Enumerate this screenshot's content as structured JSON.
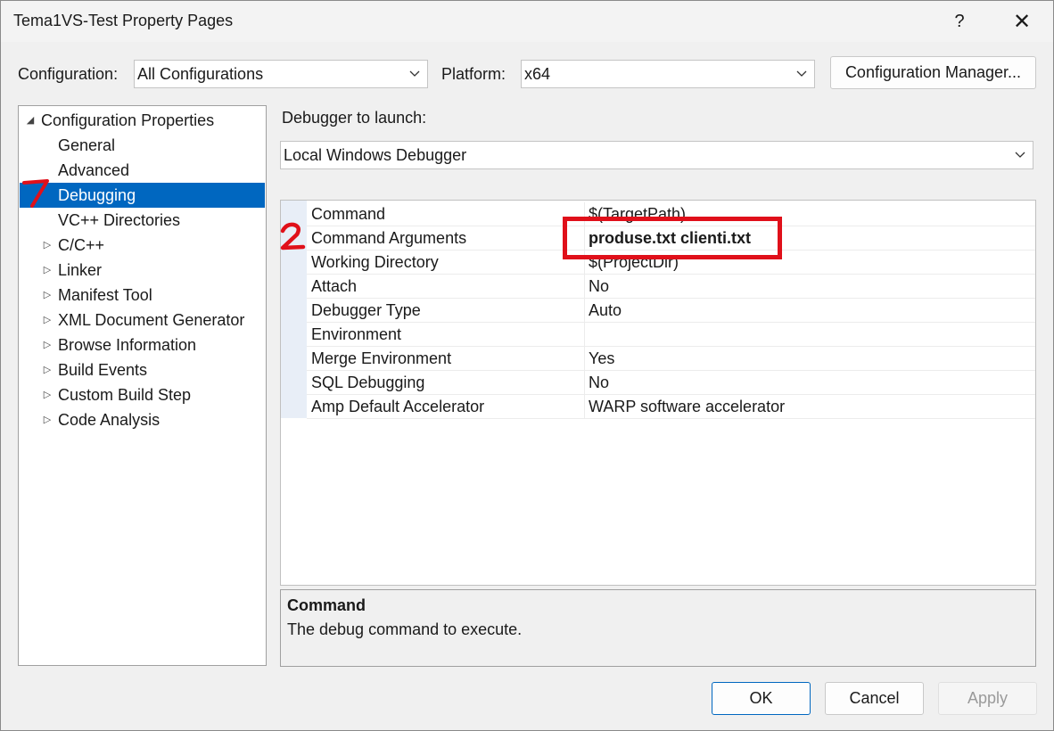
{
  "window": {
    "title": "Tema1VS-Test Property Pages",
    "help_glyph": "?",
    "close_glyph": "✕"
  },
  "toolbar": {
    "configuration_label": "Configuration:",
    "configuration_value": "All Configurations",
    "platform_label": "Platform:",
    "platform_value": "x64",
    "config_manager_label": "Configuration Manager..."
  },
  "tree": {
    "root": {
      "label": "Configuration Properties",
      "expanded": true
    },
    "items": [
      {
        "label": "General",
        "expandable": false,
        "selected": false
      },
      {
        "label": "Advanced",
        "expandable": false,
        "selected": false
      },
      {
        "label": "Debugging",
        "expandable": false,
        "selected": true
      },
      {
        "label": "VC++ Directories",
        "expandable": false,
        "selected": false
      },
      {
        "label": "C/C++",
        "expandable": true,
        "selected": false
      },
      {
        "label": "Linker",
        "expandable": true,
        "selected": false
      },
      {
        "label": "Manifest Tool",
        "expandable": true,
        "selected": false
      },
      {
        "label": "XML Document Generator",
        "expandable": true,
        "selected": false
      },
      {
        "label": "Browse Information",
        "expandable": true,
        "selected": false
      },
      {
        "label": "Build Events",
        "expandable": true,
        "selected": false
      },
      {
        "label": "Custom Build Step",
        "expandable": true,
        "selected": false
      },
      {
        "label": "Code Analysis",
        "expandable": true,
        "selected": false
      }
    ]
  },
  "debugger": {
    "launch_label": "Debugger to launch:",
    "launch_value": "Local Windows Debugger"
  },
  "properties": {
    "rows": [
      {
        "name": "Command",
        "value": "$(TargetPath)"
      },
      {
        "name": "Command Arguments",
        "value": "produse.txt clienti.txt"
      },
      {
        "name": "Working Directory",
        "value": "$(ProjectDir)"
      },
      {
        "name": "Attach",
        "value": "No"
      },
      {
        "name": "Debugger Type",
        "value": "Auto"
      },
      {
        "name": "Environment",
        "value": ""
      },
      {
        "name": "Merge Environment",
        "value": "Yes"
      },
      {
        "name": "SQL Debugging",
        "value": "No"
      },
      {
        "name": "Amp Default Accelerator",
        "value": "WARP software accelerator"
      }
    ],
    "highlighted_row": 1
  },
  "description": {
    "title": "Command",
    "text": "The debug command to execute."
  },
  "buttons": {
    "ok": "OK",
    "cancel": "Cancel",
    "apply": "Apply",
    "apply_enabled": false
  },
  "annotations": {
    "step1": "1",
    "step2": "2",
    "color": "#e0101a"
  },
  "colors": {
    "selection": "#0067c0",
    "dialog_bg": "#f0f0f0"
  }
}
